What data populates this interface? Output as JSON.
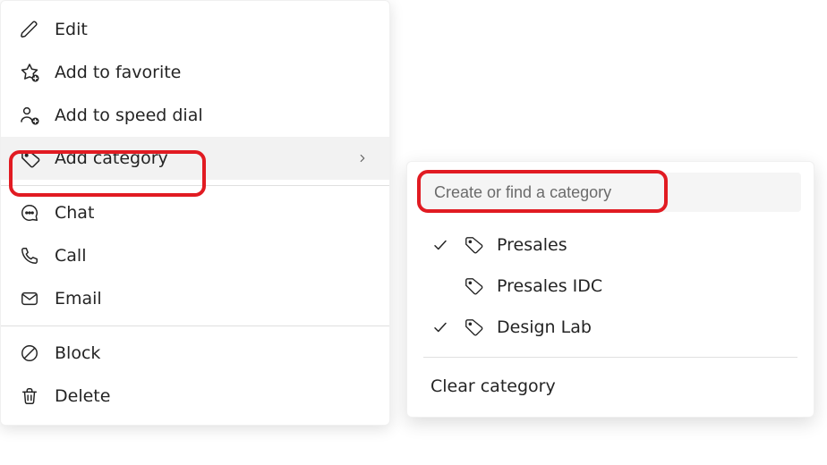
{
  "menu": {
    "items": [
      {
        "id": "edit",
        "label": "Edit"
      },
      {
        "id": "favorite",
        "label": "Add to favorite"
      },
      {
        "id": "speed-dial",
        "label": "Add to speed dial"
      },
      {
        "id": "add-category",
        "label": "Add category",
        "highlighted": true,
        "has_submenu": true
      },
      {
        "id": "chat",
        "label": "Chat"
      },
      {
        "id": "call",
        "label": "Call"
      },
      {
        "id": "email",
        "label": "Email"
      },
      {
        "id": "block",
        "label": "Block"
      },
      {
        "id": "delete",
        "label": "Delete"
      }
    ]
  },
  "category_panel": {
    "search_placeholder": "Create or find a category",
    "categories": [
      {
        "label": "Presales",
        "selected": true
      },
      {
        "label": "Presales IDC",
        "selected": false
      },
      {
        "label": "Design Lab",
        "selected": true
      }
    ],
    "clear_label": "Clear category"
  }
}
